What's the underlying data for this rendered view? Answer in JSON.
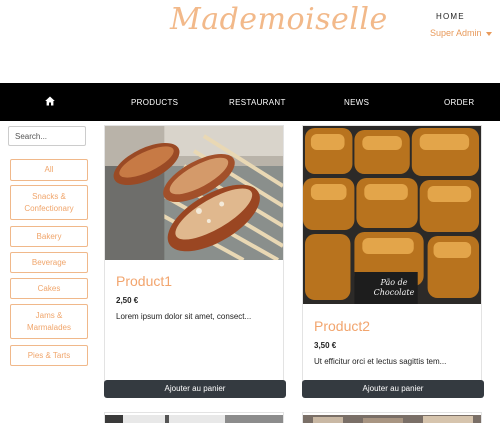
{
  "header": {
    "brand": "Mademoiselle",
    "home_link": "HOME",
    "user_menu": "Super Admin"
  },
  "nav": {
    "items": [
      "PRODUCTS",
      "RESTAURANT",
      "NEWS",
      "ORDER"
    ]
  },
  "sidebar": {
    "search_placeholder": "Search...",
    "categories": [
      "All",
      "Snacks & Confectionary",
      "Bakery",
      "Beverage",
      "Cakes",
      "Jams & Marmalades",
      "Pies & Tarts"
    ]
  },
  "products": [
    {
      "name": "Product1",
      "price": "2,50 €",
      "description": "Lorem ipsum dolor sit amet, consect...",
      "button": "Ajouter au panier"
    },
    {
      "name": "Product2",
      "price": "3,50 €",
      "description": "Ut efficitur orci et lectus sagittis tem...",
      "button": "Ajouter au panier",
      "image_caption": "Pão de Chocolate"
    }
  ],
  "colors": {
    "accent": "#f2a56e",
    "navbar": "#000000",
    "button": "#343a40"
  }
}
